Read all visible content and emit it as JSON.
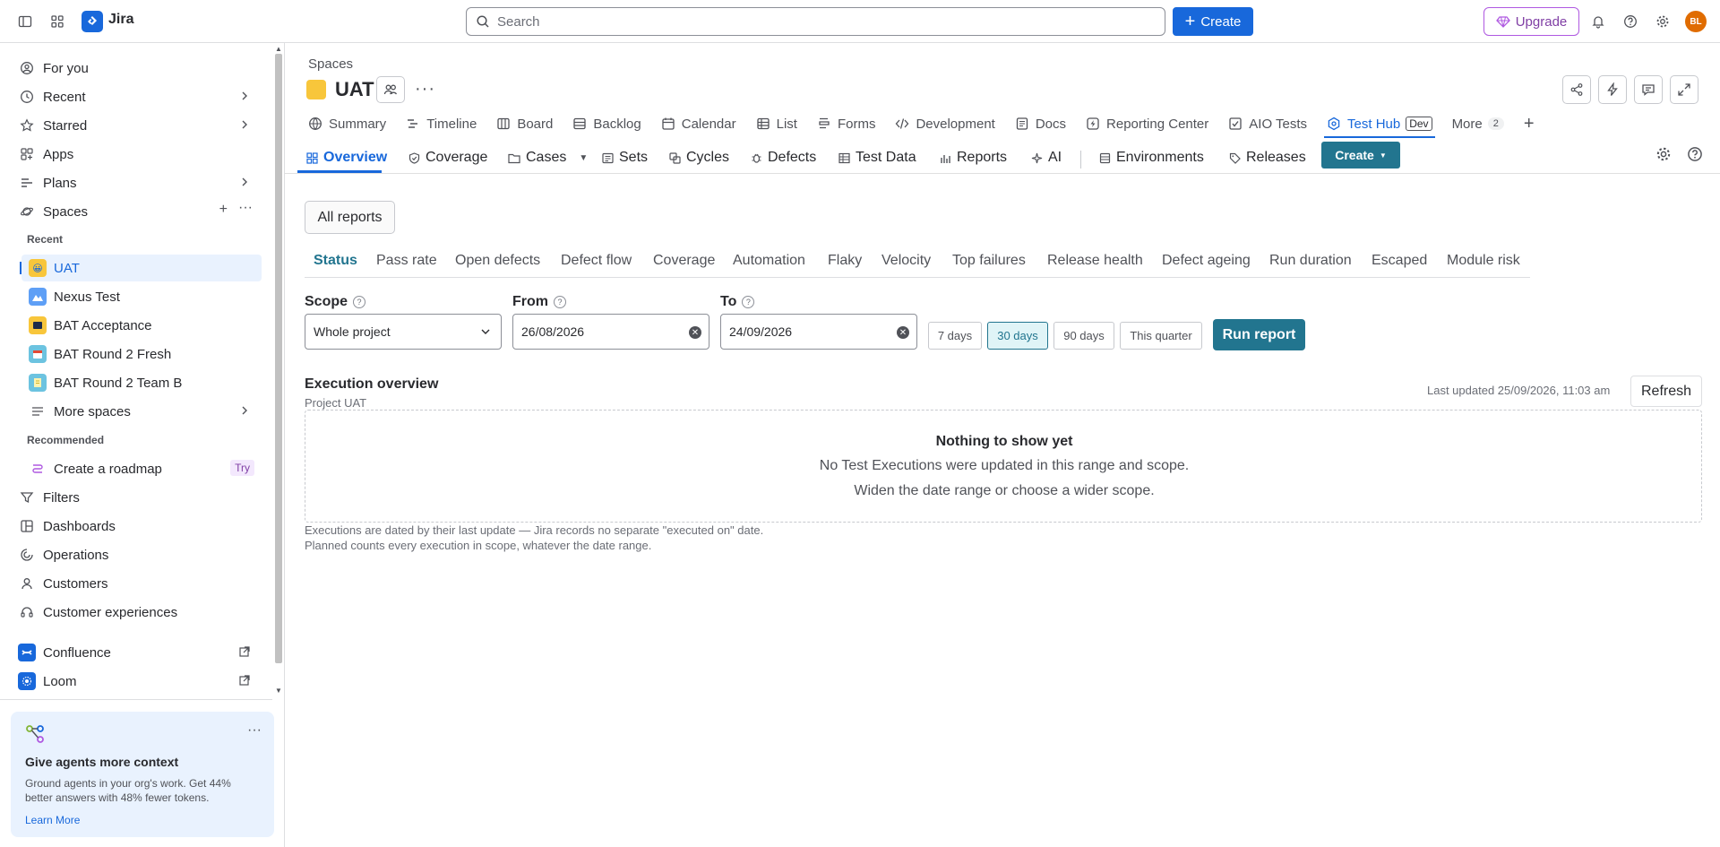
{
  "topbar": {
    "app_name": "Jira",
    "search_placeholder": "Search",
    "create_label": "Create",
    "upgrade_label": "Upgrade",
    "avatar_initials": "BL"
  },
  "sidebar": {
    "items": [
      {
        "label": "For you"
      },
      {
        "label": "Recent"
      },
      {
        "label": "Starred"
      },
      {
        "label": "Apps"
      },
      {
        "label": "Plans"
      },
      {
        "label": "Spaces"
      }
    ],
    "recent_heading": "Recent",
    "spaces": [
      {
        "label": "UAT"
      },
      {
        "label": "Nexus Test"
      },
      {
        "label": "BAT Acceptance"
      },
      {
        "label": "BAT Round 2 Fresh"
      },
      {
        "label": "BAT Round 2 Team B"
      }
    ],
    "more_spaces": "More spaces",
    "recommended_heading": "Recommended",
    "roadmap_label": "Create a roadmap",
    "try_label": "Try",
    "lower_items": [
      {
        "label": "Filters"
      },
      {
        "label": "Dashboards"
      },
      {
        "label": "Operations"
      },
      {
        "label": "Customers"
      },
      {
        "label": "Customer experiences"
      }
    ],
    "apps": [
      {
        "label": "Confluence"
      },
      {
        "label": "Loom"
      }
    ],
    "promo": {
      "title": "Give agents more context",
      "text": "Ground agents in your org's work. Get 44% better answers with 48% fewer tokens.",
      "link": "Learn More"
    }
  },
  "header": {
    "breadcrumb": "Spaces",
    "project_name": "UAT"
  },
  "nav_tabs": [
    {
      "label": "Summary"
    },
    {
      "label": "Timeline"
    },
    {
      "label": "Board"
    },
    {
      "label": "Backlog"
    },
    {
      "label": "Calendar"
    },
    {
      "label": "List"
    },
    {
      "label": "Forms"
    },
    {
      "label": "Development"
    },
    {
      "label": "Docs"
    },
    {
      "label": "Reporting Center"
    },
    {
      "label": "AIO Tests"
    },
    {
      "label": "Test Hub",
      "badge": "Dev"
    },
    {
      "label": "More",
      "badge": "2"
    }
  ],
  "sub_tabs": [
    {
      "label": "Overview"
    },
    {
      "label": "Coverage"
    },
    {
      "label": "Cases"
    },
    {
      "label": "Sets"
    },
    {
      "label": "Cycles"
    },
    {
      "label": "Defects"
    },
    {
      "label": "Test Data"
    },
    {
      "label": "Reports"
    },
    {
      "label": "AI"
    },
    {
      "label": "Environments"
    },
    {
      "label": "Releases"
    }
  ],
  "sub_create_label": "Create",
  "all_reports_label": "All reports",
  "report_tabs": [
    {
      "label": "Status"
    },
    {
      "label": "Pass rate"
    },
    {
      "label": "Open defects"
    },
    {
      "label": "Defect flow"
    },
    {
      "label": "Coverage"
    },
    {
      "label": "Automation"
    },
    {
      "label": "Flaky"
    },
    {
      "label": "Velocity"
    },
    {
      "label": "Top failures"
    },
    {
      "label": "Release health"
    },
    {
      "label": "Defect ageing"
    },
    {
      "label": "Run duration"
    },
    {
      "label": "Escaped"
    },
    {
      "label": "Module risk"
    }
  ],
  "filters": {
    "scope_label": "Scope",
    "scope_value": "Whole project",
    "from_label": "From",
    "from_value": "26/08/2026",
    "to_label": "To",
    "to_value": "24/09/2026",
    "presets": [
      {
        "label": "7 days"
      },
      {
        "label": "30 days"
      },
      {
        "label": "90 days"
      },
      {
        "label": "This quarter"
      }
    ],
    "run_label": "Run report"
  },
  "execution": {
    "title": "Execution overview",
    "subtitle": "Project UAT",
    "last_updated": "Last updated 25/09/2026, 11:03 am",
    "refresh_label": "Refresh",
    "empty_title": "Nothing to show yet",
    "empty_line1": "No Test Executions were updated in this range and scope.",
    "empty_line2": "Widen the date range or choose a wider scope.",
    "footnote1": "Executions are dated by their last update — Jira records no separate \"executed on\" date.",
    "footnote2": "Planned counts every execution in scope, whatever the date range."
  },
  "colors": {
    "brand_blue": "#1868db",
    "teal": "#22758f",
    "upgrade_purple": "#803fa5"
  }
}
